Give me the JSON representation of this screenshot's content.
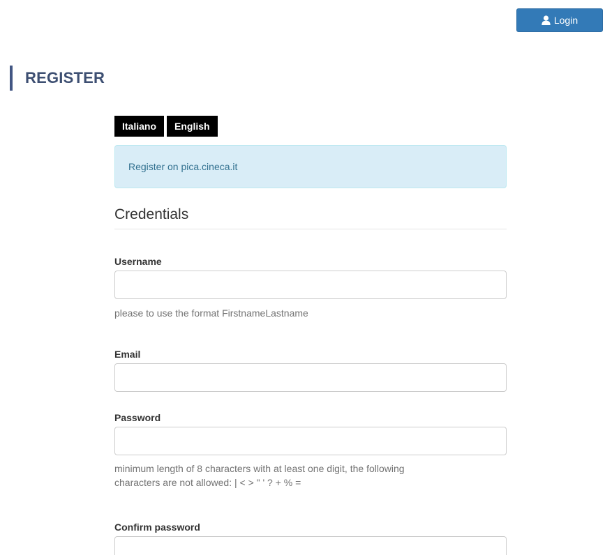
{
  "header": {
    "login_label": "Login",
    "login_icon": "user-icon"
  },
  "page_title": "REGISTER",
  "languages": [
    "Italiano",
    "English"
  ],
  "info_message": "Register on pica.cineca.it",
  "section_title": "Credentials",
  "fields": {
    "username": {
      "label": "Username",
      "value": "",
      "help": "please to use the format FirstnameLastname"
    },
    "email": {
      "label": "Email",
      "value": ""
    },
    "password": {
      "label": "Password",
      "value": "",
      "help_line1": "minimum length of 8 characters with at least one digit, the following",
      "help_line2": "characters are not allowed: | < > \" ' ? + % ="
    },
    "confirm_password": {
      "label": "Confirm password",
      "value": ""
    }
  },
  "colors": {
    "primary_button": "#337ab7",
    "title_accent": "#425683",
    "info_bg": "#d9edf7",
    "info_text": "#31708f"
  }
}
